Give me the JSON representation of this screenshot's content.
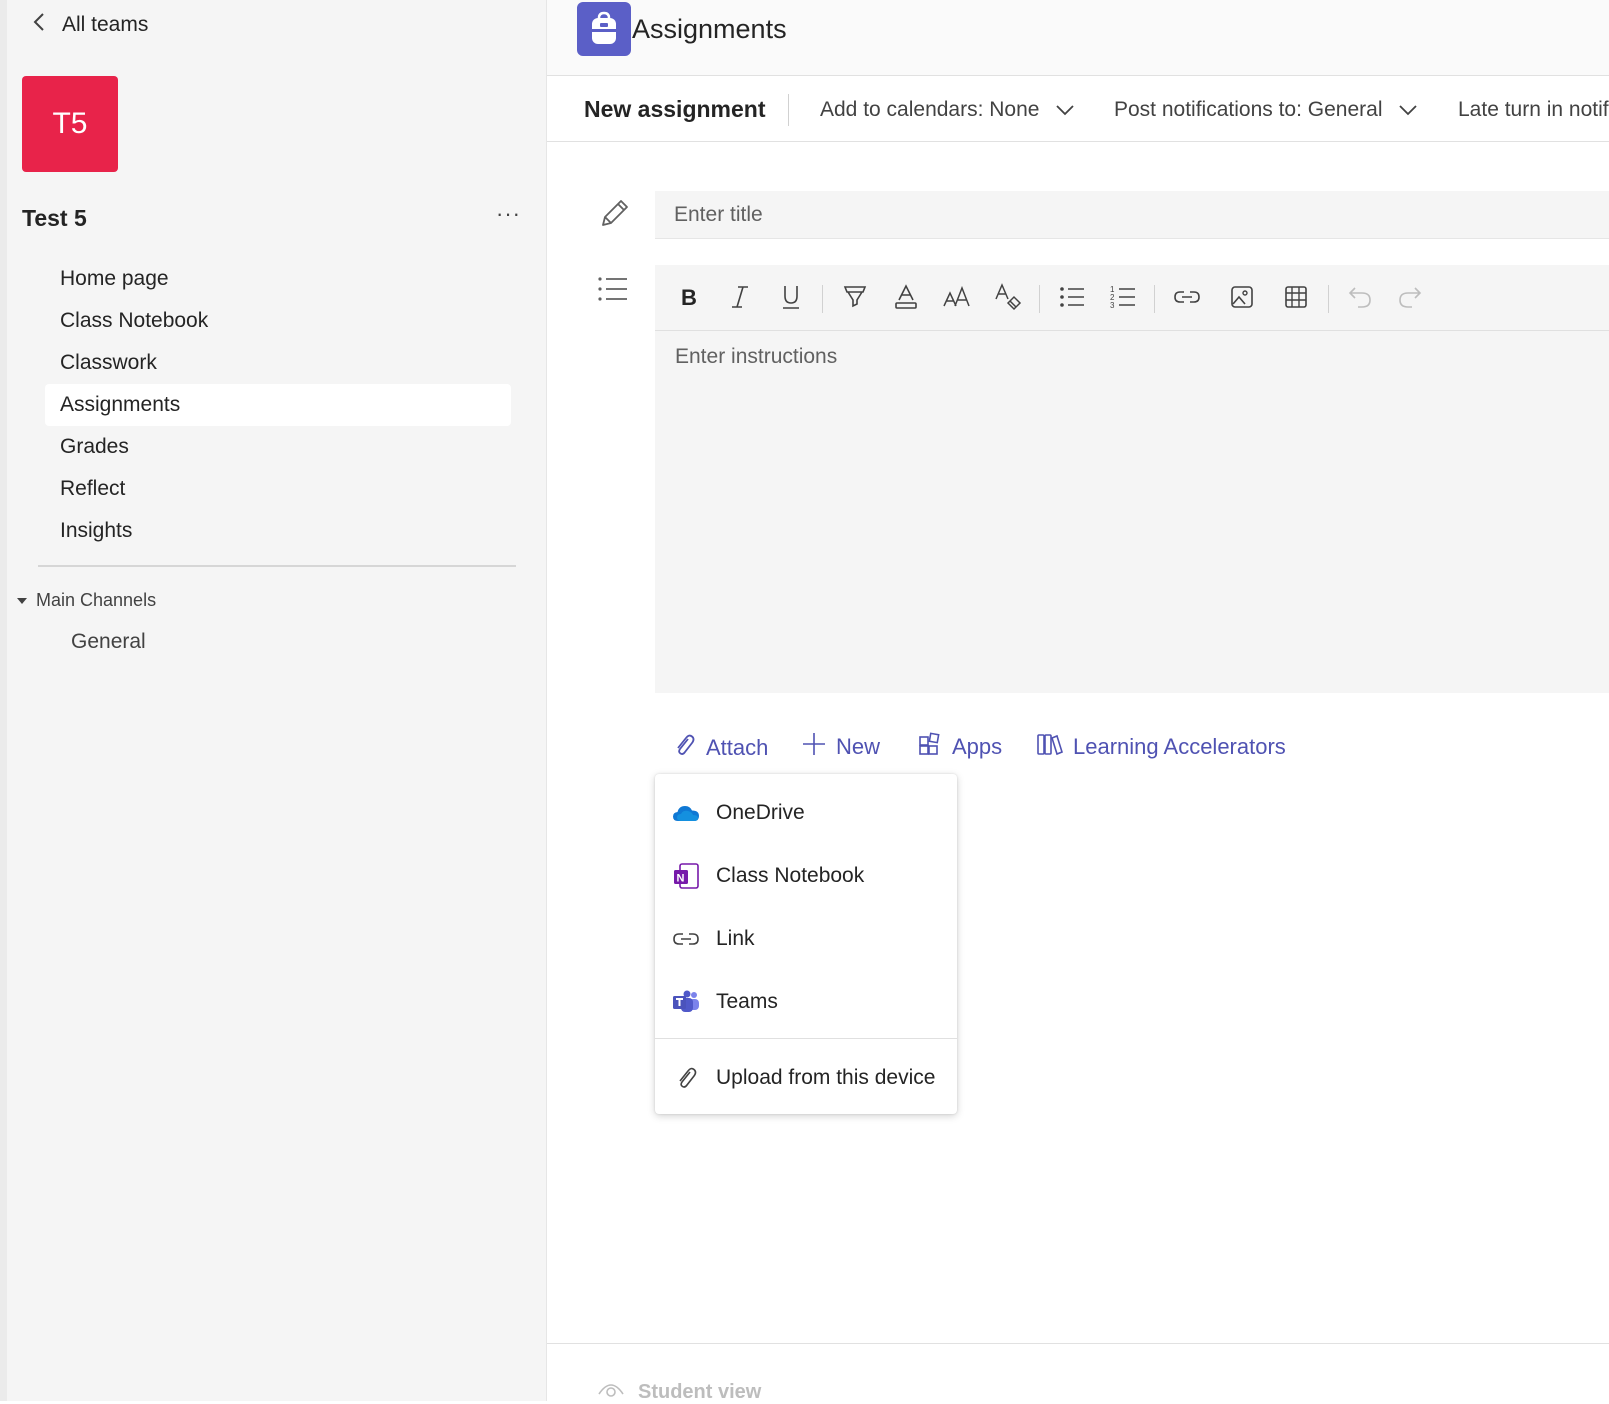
{
  "sidebar": {
    "back_label": "All teams",
    "avatar_text": "T5",
    "avatar_color": "#e8234a",
    "team_name": "Test 5",
    "more_label": "···",
    "nav_items": [
      {
        "label": "Home page"
      },
      {
        "label": "Class Notebook"
      },
      {
        "label": "Classwork"
      },
      {
        "label": "Assignments",
        "active": true
      },
      {
        "label": "Grades"
      },
      {
        "label": "Reflect"
      },
      {
        "label": "Insights"
      }
    ],
    "channels_header": "Main Channels",
    "channels": [
      {
        "label": "General"
      }
    ]
  },
  "header": {
    "app_title": "Assignments",
    "app_icon": "backpack-icon",
    "accent": "#5b5fc7"
  },
  "toolbar": {
    "new_assignment": "New assignment",
    "calendars": "Add to calendars: None",
    "notifications": "Post notifications to: General",
    "late": "Late turn in notif"
  },
  "form": {
    "title_placeholder": "Enter title",
    "instructions_placeholder": "Enter instructions",
    "format_buttons": [
      "bold-icon",
      "italic-icon",
      "underline-icon",
      "highlight-icon",
      "font-color-icon",
      "font-size-icon",
      "clear-format-icon",
      "bullet-list-icon",
      "numbered-list-icon",
      "link-icon",
      "image-icon",
      "table-icon",
      "undo-icon",
      "redo-icon"
    ]
  },
  "actions": {
    "attach": "Attach",
    "new": "New",
    "apps": "Apps",
    "learning": "Learning Accelerators",
    "link_color": "#4f52b2"
  },
  "attach_menu": {
    "items": [
      {
        "label": "OneDrive",
        "icon": "onedrive-icon"
      },
      {
        "label": "Class Notebook",
        "icon": "onenote-icon"
      },
      {
        "label": "Link",
        "icon": "link-icon"
      },
      {
        "label": "Teams",
        "icon": "teams-icon"
      }
    ],
    "upload": {
      "label": "Upload from this device",
      "icon": "paperclip-icon"
    }
  },
  "footer": {
    "student_view": "Student view"
  }
}
